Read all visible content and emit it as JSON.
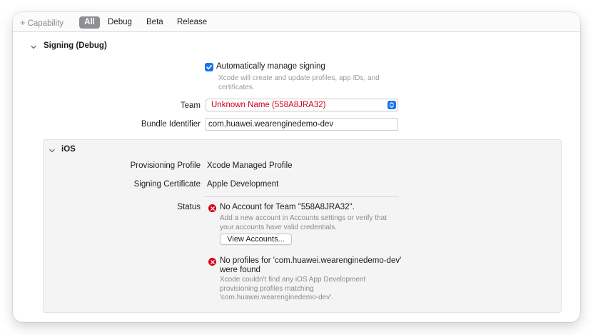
{
  "toolbar": {
    "capability_label": "Capability",
    "tabs": [
      {
        "label": "All",
        "selected": true
      },
      {
        "label": "Debug",
        "selected": false
      },
      {
        "label": "Beta",
        "selected": false
      },
      {
        "label": "Release",
        "selected": false
      }
    ]
  },
  "signing": {
    "section_title": "Signing (Debug)",
    "auto_manage": {
      "label": "Automatically manage signing",
      "checked": true,
      "description": "Xcode will create and update profiles, app IDs, and certificates."
    },
    "team": {
      "label": "Team",
      "value": "Unknown Name (558A8JRA32)",
      "value_color": "#d0021b"
    },
    "bundle_identifier": {
      "label": "Bundle Identifier",
      "value": "com.huawei.wearenginedemo-dev"
    }
  },
  "ios": {
    "title": "iOS",
    "provisioning_profile": {
      "label": "Provisioning Profile",
      "value": "Xcode Managed Profile"
    },
    "signing_certificate": {
      "label": "Signing Certificate",
      "value": "Apple Development"
    },
    "status": {
      "label": "Status",
      "errors": [
        {
          "title": "No Account for Team \"558A8JRA32\".",
          "description": "Add a new account in Accounts settings or verify that your accounts have valid credentials.",
          "button_label": "View Accounts..."
        },
        {
          "title": "No profiles for 'com.huawei.wearenginedemo-dev' were found",
          "description": "Xcode couldn't find any iOS App Development provisioning profiles matching 'com.huawei.wearenginedemo-dev'."
        }
      ]
    }
  },
  "colors": {
    "accent": "#1a73e8",
    "error": "#d70015",
    "selected_tab_bg": "#8e8e93"
  }
}
